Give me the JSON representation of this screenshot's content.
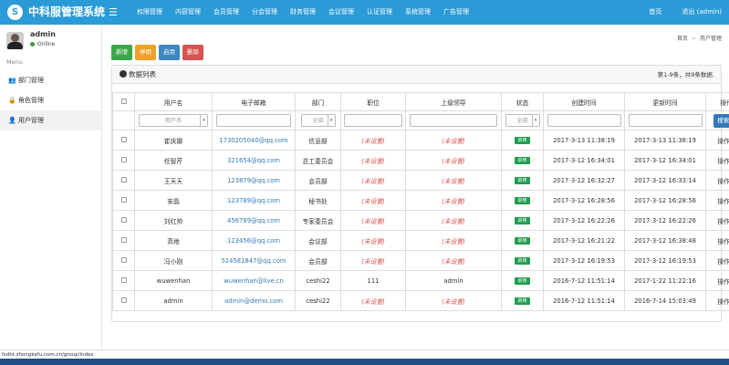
{
  "app": {
    "logo_mark": "S",
    "title": "中科服管理系统"
  },
  "topnav": [
    "权限管理",
    "内容管理",
    "会员管理",
    "分会管理",
    "财务管理",
    "会议管理",
    "认证管理",
    "系统管理",
    "广告管理"
  ],
  "topright": {
    "home": "首页",
    "logout": "退出 (admin)"
  },
  "sidebar": {
    "user": "admin",
    "status": "Online",
    "menu_label": "Menu",
    "items": [
      {
        "label": "部门管理",
        "icon": "users-icon"
      },
      {
        "label": "角色管理",
        "icon": "lock-icon"
      },
      {
        "label": "用户管理",
        "icon": "user-icon"
      }
    ]
  },
  "breadcrumb": {
    "home": "首页",
    "sep": ">",
    "current": "用户管理"
  },
  "toolbar": {
    "add": "新增",
    "disable": "停用",
    "enable": "启用",
    "delete": "删除"
  },
  "panel": {
    "title": "数据列表",
    "count": "第1-9条，共9条数据."
  },
  "table": {
    "headers": [
      "用户名",
      "电子邮箱",
      "部门",
      "职位",
      "上级领导",
      "状态",
      "创建时间",
      "更新时间",
      "操作"
    ],
    "filters": {
      "username_placeholder": "用户名",
      "dept_value": "全部",
      "status_value": "全部",
      "search_button": "搜索栏"
    },
    "rows": [
      {
        "username": "崔庆娜",
        "email": "1730205040@qq.com",
        "dept": "信息部",
        "position": "(未设置)",
        "leader": "(未设置)",
        "status": "启用",
        "created": "2017-3-13 11:38:19",
        "updated": "2017-3-13 11:38:19",
        "op": "操作 ▾"
      },
      {
        "username": "任智芹",
        "email": "321654@qq.com",
        "dept": "总工委员会",
        "position": "(未设置)",
        "leader": "(未设置)",
        "status": "启用",
        "created": "2017-3-12 16:34:01",
        "updated": "2017-3-12 16:34:01",
        "op": "操作 ▾"
      },
      {
        "username": "王天天",
        "email": "123879@qq.com",
        "dept": "会员部",
        "position": "(未设置)",
        "leader": "(未设置)",
        "status": "启用",
        "created": "2017-3-12 16:32:27",
        "updated": "2017-3-12 16:33:14",
        "op": "操作 ▾"
      },
      {
        "username": "安晶",
        "email": "123789@qq.com",
        "dept": "秘书处",
        "position": "(未设置)",
        "leader": "(未设置)",
        "status": "启用",
        "created": "2017-3-12 16:28:56",
        "updated": "2017-3-12 16:28:56",
        "op": "操作 ▾"
      },
      {
        "username": "刘红帅",
        "email": "456789@qq.com",
        "dept": "专家委员会",
        "position": "(未设置)",
        "leader": "(未设置)",
        "status": "启用",
        "created": "2017-3-12 16:22:26",
        "updated": "2017-3-12 16:22:26",
        "op": "操作 ▾"
      },
      {
        "username": "高地",
        "email": "123456@qq.com",
        "dept": "会议部",
        "position": "(未设置)",
        "leader": "(未设置)",
        "status": "启用",
        "created": "2017-3-12 16:21:22",
        "updated": "2017-3-12 16:38:48",
        "op": "操作 ▾"
      },
      {
        "username": "冯小刚",
        "email": "524581847@qq.com",
        "dept": "会员部",
        "position": "(未设置)",
        "leader": "(未设置)",
        "status": "启用",
        "created": "2017-3-12 16:19:53",
        "updated": "2017-3-12 16:19:53",
        "op": "操作 ▾"
      },
      {
        "username": "wuwenhan",
        "email": "wuwenhan@live.cn",
        "dept": "ceshi22",
        "position": "111",
        "leader": "admin",
        "status": "启用",
        "created": "2016-7-12 11:51:14",
        "updated": "2017-1-22 11:22:16",
        "op": "操作 ▾"
      },
      {
        "username": "admin",
        "email": "admin@demo.com",
        "dept": "ceshi22",
        "position": "(未设置)",
        "leader": "(未设置)",
        "status": "启用",
        "created": "2016-7-12 11:51:14",
        "updated": "2016-7-14 15:03:49",
        "op": "操作 ▾"
      }
    ]
  },
  "statusbar": "fsdht.zhongkefu.com.cn/group/index",
  "colors": {
    "topbar": "#2a9bd6",
    "add": "#3aa84a",
    "disable": "#f0a028",
    "enable": "#3d87c2",
    "delete": "#d9534f",
    "badge": "#1e9e4f",
    "link": "#337ab7",
    "unset": "#d9534f"
  }
}
